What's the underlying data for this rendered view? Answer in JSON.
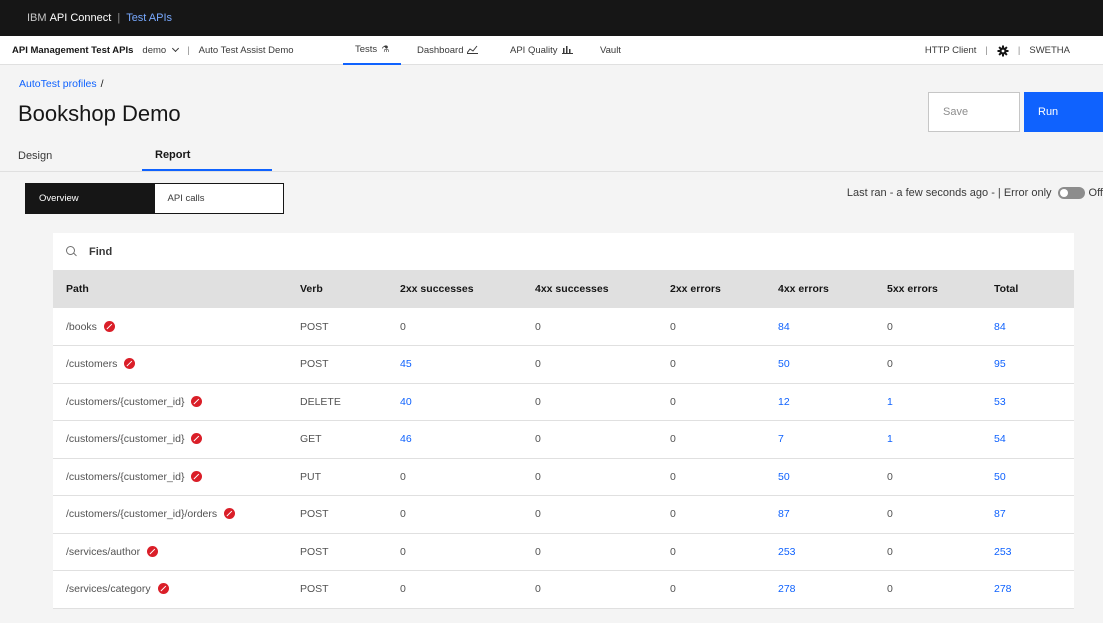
{
  "topbar": {
    "brand_prefix": "IBM",
    "brand_name": "API Connect",
    "separator": "|",
    "context": "Test APIs"
  },
  "nav": {
    "catalog": "API Management Test APIs",
    "space": "demo",
    "project": "Auto Test Assist Demo",
    "tabs": [
      {
        "label": "Tests",
        "icon": "flask-icon"
      },
      {
        "label": "Dashboard",
        "icon": "chart-line-icon"
      },
      {
        "label": "API Quality",
        "icon": "chart-bar-icon"
      },
      {
        "label": "Vault",
        "icon": ""
      }
    ],
    "http_client": "HTTP Client",
    "user": "SWETHA"
  },
  "breadcrumb": {
    "parent": "AutoTest profiles",
    "separator": "/"
  },
  "page_title": "Bookshop Demo",
  "actions": {
    "save": "Save",
    "run": "Run"
  },
  "tabs": {
    "design": "Design",
    "report": "Report"
  },
  "switcher": {
    "overview": "Overview",
    "api_calls": "API calls"
  },
  "status": {
    "last_ran": "Last ran - a few seconds ago - | Error only",
    "toggle_state": "Off"
  },
  "search": {
    "placeholder": "Find"
  },
  "table": {
    "headers": {
      "path": "Path",
      "verb": "Verb",
      "s2xx": "2xx successes",
      "s4xx": "4xx successes",
      "e2xx": "2xx errors",
      "e4xx": "4xx errors",
      "e5xx": "5xx errors",
      "total": "Total"
    },
    "rows": [
      {
        "path": "/books",
        "verb": "POST",
        "s2xx": "0",
        "s4xx": "0",
        "e2xx": "0",
        "e4xx": "84",
        "e5xx": "0",
        "total": "84"
      },
      {
        "path": "/customers",
        "verb": "POST",
        "s2xx": "45",
        "s4xx": "0",
        "e2xx": "0",
        "e4xx": "50",
        "e5xx": "0",
        "total": "95"
      },
      {
        "path": "/customers/{customer_id}",
        "verb": "DELETE",
        "s2xx": "40",
        "s4xx": "0",
        "e2xx": "0",
        "e4xx": "12",
        "e5xx": "1",
        "total": "53"
      },
      {
        "path": "/customers/{customer_id}",
        "verb": "GET",
        "s2xx": "46",
        "s4xx": "0",
        "e2xx": "0",
        "e4xx": "7",
        "e5xx": "1",
        "total": "54"
      },
      {
        "path": "/customers/{customer_id}",
        "verb": "PUT",
        "s2xx": "0",
        "s4xx": "0",
        "e2xx": "0",
        "e4xx": "50",
        "e5xx": "0",
        "total": "50"
      },
      {
        "path": "/customers/{customer_id}/orders",
        "verb": "POST",
        "s2xx": "0",
        "s4xx": "0",
        "e2xx": "0",
        "e4xx": "87",
        "e5xx": "0",
        "total": "87"
      },
      {
        "path": "/services/author",
        "verb": "POST",
        "s2xx": "0",
        "s4xx": "0",
        "e2xx": "0",
        "e4xx": "253",
        "e5xx": "0",
        "total": "253"
      },
      {
        "path": "/services/category",
        "verb": "POST",
        "s2xx": "0",
        "s4xx": "0",
        "e2xx": "0",
        "e4xx": "278",
        "e5xx": "0",
        "total": "278"
      }
    ]
  },
  "colors": {
    "link": "#0f62fe",
    "error": "#da1e28",
    "topbar": "#161616"
  }
}
